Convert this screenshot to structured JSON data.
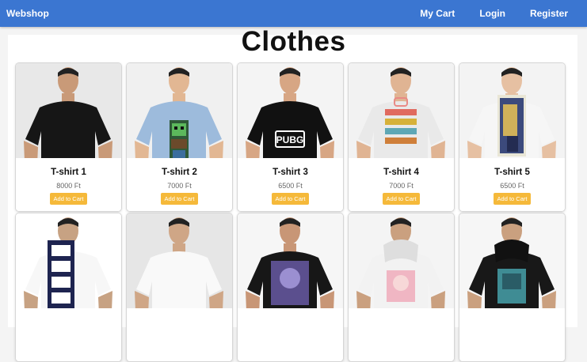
{
  "nav": {
    "brand": "Webshop",
    "links": [
      "My Cart",
      "Login",
      "Register"
    ]
  },
  "page_title": "Clothes",
  "products": [
    {
      "name": "T-shirt 1",
      "price": "8000 Ft",
      "cta": "Add to Cart",
      "shirt_color": "#161616",
      "bg": "#e8e8e8",
      "skin": "#c99a78",
      "graphic": "none"
    },
    {
      "name": "T-shirt 2",
      "price": "7000 Ft",
      "cta": "Add to Cart",
      "shirt_color": "#9dbbdc",
      "bg": "#f0f0f0",
      "skin": "#e2b793",
      "graphic": "minecraft"
    },
    {
      "name": "T-shirt 3",
      "price": "6500 Ft",
      "cta": "Add to Cart",
      "shirt_color": "#111111",
      "bg": "#f4f4f4",
      "skin": "#d7a684",
      "graphic": "PUBG"
    },
    {
      "name": "T-shirt 4",
      "price": "7000 Ft",
      "cta": "Add to Cart",
      "shirt_color": "#e9e9e9",
      "bg": "#f2f2f2",
      "skin": "#e0b493",
      "graphic": "gamer"
    },
    {
      "name": "T-shirt 5",
      "price": "6500 Ft",
      "cta": "Add to Cart",
      "shirt_color": "#f6f6f6",
      "bg": "#f3f3f3",
      "skin": "#e6c0a2",
      "graphic": "anime"
    },
    {
      "name": "",
      "price": "",
      "cta": "",
      "shirt_color": "#f7f7f7",
      "bg": "#ffffff",
      "skin": "#c7a283",
      "graphic": "manga"
    },
    {
      "name": "",
      "price": "",
      "cta": "",
      "shirt_color": "#f9f9f9",
      "bg": "#e6e6e6",
      "skin": "#cfa686",
      "graphic": "none"
    },
    {
      "name": "",
      "price": "",
      "cta": "",
      "shirt_color": "#171717",
      "bg": "#f6f6f6",
      "skin": "#c89676",
      "graphic": "purple"
    },
    {
      "name": "",
      "price": "",
      "cta": "",
      "shirt_color": "#f2f2f2",
      "bg": "#f4f4f4",
      "skin": "#caa07f",
      "graphic": "hoodie-pink"
    },
    {
      "name": "",
      "price": "",
      "cta": "",
      "shirt_color": "#181818",
      "bg": "#f6f6f6",
      "skin": "#caa07f",
      "graphic": "hoodie-teal"
    }
  ]
}
